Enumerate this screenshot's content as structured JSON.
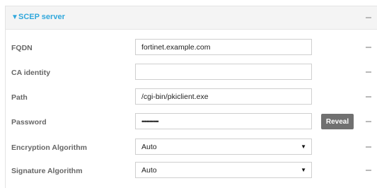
{
  "section": {
    "toggle_icon": "triangle-down-icon",
    "title": "SCEP server"
  },
  "fields": [
    {
      "label": "FQDN",
      "value": "fortinet.example.com"
    },
    {
      "label": "CA identity",
      "value": ""
    },
    {
      "label": "Path",
      "value": "/cgi-bin/pkiclient.exe"
    },
    {
      "label": "Password",
      "value": "•••••••••••"
    },
    {
      "label": "Encryption Algorithm",
      "value": "Auto"
    },
    {
      "label": "Signature Algorithm",
      "value": "Auto"
    }
  ],
  "buttons": {
    "reveal": "Reveal"
  },
  "colors": {
    "accent": "#31a8dc",
    "button_bg": "#707070",
    "header_bg": "#f4f4f4"
  }
}
